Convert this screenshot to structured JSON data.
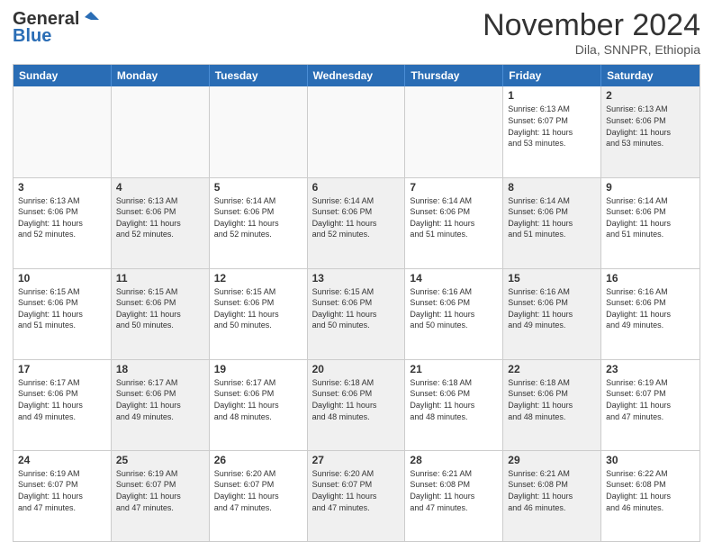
{
  "logo": {
    "general": "General",
    "blue": "Blue"
  },
  "header": {
    "month": "November 2024",
    "location": "Dila, SNNPR, Ethiopia"
  },
  "days_of_week": [
    "Sunday",
    "Monday",
    "Tuesday",
    "Wednesday",
    "Thursday",
    "Friday",
    "Saturday"
  ],
  "weeks": [
    [
      {
        "day": "",
        "info": "",
        "empty": true
      },
      {
        "day": "",
        "info": "",
        "empty": true
      },
      {
        "day": "",
        "info": "",
        "empty": true
      },
      {
        "day": "",
        "info": "",
        "empty": true
      },
      {
        "day": "",
        "info": "",
        "empty": true
      },
      {
        "day": "1",
        "info": "Sunrise: 6:13 AM\nSunset: 6:07 PM\nDaylight: 11 hours\nand 53 minutes."
      },
      {
        "day": "2",
        "info": "Sunrise: 6:13 AM\nSunset: 6:06 PM\nDaylight: 11 hours\nand 53 minutes.",
        "shaded": true
      }
    ],
    [
      {
        "day": "3",
        "info": "Sunrise: 6:13 AM\nSunset: 6:06 PM\nDaylight: 11 hours\nand 52 minutes."
      },
      {
        "day": "4",
        "info": "Sunrise: 6:13 AM\nSunset: 6:06 PM\nDaylight: 11 hours\nand 52 minutes.",
        "shaded": true
      },
      {
        "day": "5",
        "info": "Sunrise: 6:14 AM\nSunset: 6:06 PM\nDaylight: 11 hours\nand 52 minutes."
      },
      {
        "day": "6",
        "info": "Sunrise: 6:14 AM\nSunset: 6:06 PM\nDaylight: 11 hours\nand 52 minutes.",
        "shaded": true
      },
      {
        "day": "7",
        "info": "Sunrise: 6:14 AM\nSunset: 6:06 PM\nDaylight: 11 hours\nand 51 minutes."
      },
      {
        "day": "8",
        "info": "Sunrise: 6:14 AM\nSunset: 6:06 PM\nDaylight: 11 hours\nand 51 minutes.",
        "shaded": true
      },
      {
        "day": "9",
        "info": "Sunrise: 6:14 AM\nSunset: 6:06 PM\nDaylight: 11 hours\nand 51 minutes."
      }
    ],
    [
      {
        "day": "10",
        "info": "Sunrise: 6:15 AM\nSunset: 6:06 PM\nDaylight: 11 hours\nand 51 minutes."
      },
      {
        "day": "11",
        "info": "Sunrise: 6:15 AM\nSunset: 6:06 PM\nDaylight: 11 hours\nand 50 minutes.",
        "shaded": true
      },
      {
        "day": "12",
        "info": "Sunrise: 6:15 AM\nSunset: 6:06 PM\nDaylight: 11 hours\nand 50 minutes."
      },
      {
        "day": "13",
        "info": "Sunrise: 6:15 AM\nSunset: 6:06 PM\nDaylight: 11 hours\nand 50 minutes.",
        "shaded": true
      },
      {
        "day": "14",
        "info": "Sunrise: 6:16 AM\nSunset: 6:06 PM\nDaylight: 11 hours\nand 50 minutes."
      },
      {
        "day": "15",
        "info": "Sunrise: 6:16 AM\nSunset: 6:06 PM\nDaylight: 11 hours\nand 49 minutes.",
        "shaded": true
      },
      {
        "day": "16",
        "info": "Sunrise: 6:16 AM\nSunset: 6:06 PM\nDaylight: 11 hours\nand 49 minutes."
      }
    ],
    [
      {
        "day": "17",
        "info": "Sunrise: 6:17 AM\nSunset: 6:06 PM\nDaylight: 11 hours\nand 49 minutes."
      },
      {
        "day": "18",
        "info": "Sunrise: 6:17 AM\nSunset: 6:06 PM\nDaylight: 11 hours\nand 49 minutes.",
        "shaded": true
      },
      {
        "day": "19",
        "info": "Sunrise: 6:17 AM\nSunset: 6:06 PM\nDaylight: 11 hours\nand 48 minutes."
      },
      {
        "day": "20",
        "info": "Sunrise: 6:18 AM\nSunset: 6:06 PM\nDaylight: 11 hours\nand 48 minutes.",
        "shaded": true
      },
      {
        "day": "21",
        "info": "Sunrise: 6:18 AM\nSunset: 6:06 PM\nDaylight: 11 hours\nand 48 minutes."
      },
      {
        "day": "22",
        "info": "Sunrise: 6:18 AM\nSunset: 6:06 PM\nDaylight: 11 hours\nand 48 minutes.",
        "shaded": true
      },
      {
        "day": "23",
        "info": "Sunrise: 6:19 AM\nSunset: 6:07 PM\nDaylight: 11 hours\nand 47 minutes."
      }
    ],
    [
      {
        "day": "24",
        "info": "Sunrise: 6:19 AM\nSunset: 6:07 PM\nDaylight: 11 hours\nand 47 minutes."
      },
      {
        "day": "25",
        "info": "Sunrise: 6:19 AM\nSunset: 6:07 PM\nDaylight: 11 hours\nand 47 minutes.",
        "shaded": true
      },
      {
        "day": "26",
        "info": "Sunrise: 6:20 AM\nSunset: 6:07 PM\nDaylight: 11 hours\nand 47 minutes."
      },
      {
        "day": "27",
        "info": "Sunrise: 6:20 AM\nSunset: 6:07 PM\nDaylight: 11 hours\nand 47 minutes.",
        "shaded": true
      },
      {
        "day": "28",
        "info": "Sunrise: 6:21 AM\nSunset: 6:08 PM\nDaylight: 11 hours\nand 47 minutes."
      },
      {
        "day": "29",
        "info": "Sunrise: 6:21 AM\nSunset: 6:08 PM\nDaylight: 11 hours\nand 46 minutes.",
        "shaded": true
      },
      {
        "day": "30",
        "info": "Sunrise: 6:22 AM\nSunset: 6:08 PM\nDaylight: 11 hours\nand 46 minutes."
      }
    ]
  ]
}
